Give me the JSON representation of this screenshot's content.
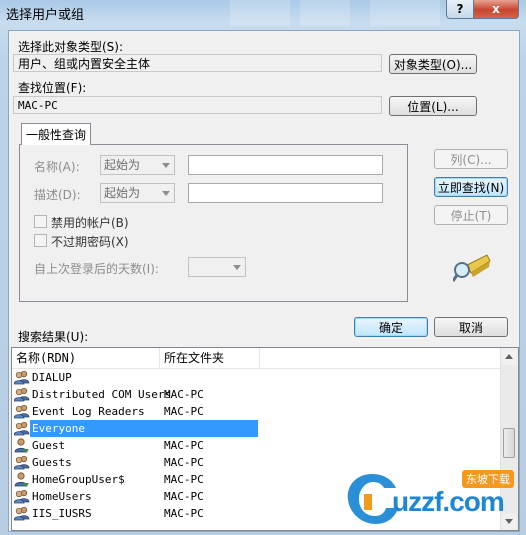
{
  "window": {
    "title": "选择用户或组",
    "help_label": "?",
    "close_label": "x"
  },
  "object_type": {
    "label": "选择此对象类型(S):",
    "value": "用户、组或内置安全主体",
    "button": "对象类型(O)..."
  },
  "location": {
    "label": "查找位置(F):",
    "value": "MAC-PC",
    "button": "位置(L)..."
  },
  "query": {
    "tab": "一般性查询",
    "name_label": "名称(A):",
    "name_mode": "起始为",
    "desc_label": "描述(D):",
    "desc_mode": "起始为",
    "disabled_accounts": "禁用的帐户(B)",
    "non_expiring_pwd": "不过期密码(X)",
    "days_since_logon": "自上次登录后的天数(I):"
  },
  "buttons": {
    "columns": "列(C)...",
    "find_now": "立即查找(N)",
    "stop": "停止(T)",
    "ok": "确定",
    "cancel": "取消"
  },
  "results": {
    "label": "搜索结果(U):",
    "col_name": "名称(RDN)",
    "col_folder": "所在文件夹",
    "rows": [
      {
        "name": "DIALUP",
        "folder": "",
        "icon": "group-icon"
      },
      {
        "name": "Distributed COM Users",
        "folder": "MAC-PC",
        "icon": "group-icon"
      },
      {
        "name": "Event Log Readers",
        "folder": "MAC-PC",
        "icon": "group-icon"
      },
      {
        "name": "Everyone",
        "folder": "",
        "icon": "group-icon",
        "selected": true
      },
      {
        "name": "Guest",
        "folder": "MAC-PC",
        "icon": "user-icon"
      },
      {
        "name": "Guests",
        "folder": "MAC-PC",
        "icon": "group-icon"
      },
      {
        "name": "HomeGroupUser$",
        "folder": "MAC-PC",
        "icon": "user-icon"
      },
      {
        "name": "HomeUsers",
        "folder": "MAC-PC",
        "icon": "group-icon"
      },
      {
        "name": "IIS_IUSRS",
        "folder": "MAC-PC",
        "icon": "group-icon"
      }
    ]
  },
  "watermark": {
    "text": "uzzf.com",
    "badge": "东坡下载"
  }
}
